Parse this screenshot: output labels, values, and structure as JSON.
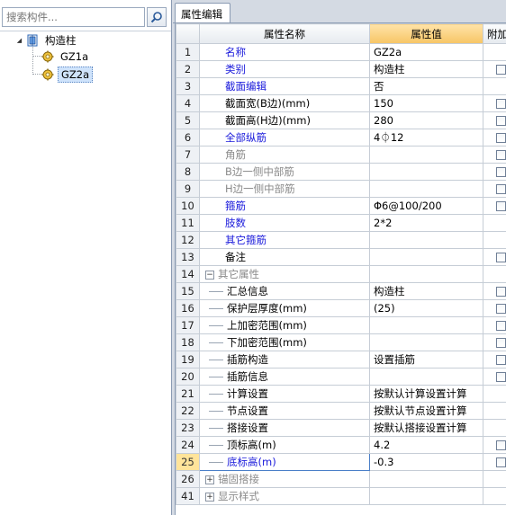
{
  "search": {
    "placeholder": "搜索构件..."
  },
  "tree": {
    "root_label": "构造柱",
    "children": [
      {
        "label": "GZ1a",
        "selected": false
      },
      {
        "label": "GZ2a",
        "selected": true
      }
    ]
  },
  "tab": {
    "label": "属性编辑"
  },
  "grid": {
    "headers": {
      "name": "属性名称",
      "value": "属性值",
      "extra": "附加"
    },
    "rows": [
      {
        "num": "1",
        "name": "名称",
        "value": "GZ2a",
        "style": "blue",
        "check": false
      },
      {
        "num": "2",
        "name": "类别",
        "value": "构造柱",
        "style": "blue",
        "check": true
      },
      {
        "num": "3",
        "name": "截面编辑",
        "value": "否",
        "style": "blue",
        "check": false
      },
      {
        "num": "4",
        "name": "截面宽(B边)(mm)",
        "value": "150",
        "style": "black",
        "check": true
      },
      {
        "num": "5",
        "name": "截面高(H边)(mm)",
        "value": "280",
        "style": "black",
        "check": true
      },
      {
        "num": "6",
        "name": "全部纵筋",
        "value": "4⏀12",
        "style": "blue",
        "check": true
      },
      {
        "num": "7",
        "name": "角筋",
        "value": "",
        "style": "gray",
        "check": true
      },
      {
        "num": "8",
        "name": "B边一侧中部筋",
        "value": "",
        "style": "gray",
        "check": true
      },
      {
        "num": "9",
        "name": "H边一侧中部筋",
        "value": "",
        "style": "gray",
        "check": true
      },
      {
        "num": "10",
        "name": "箍筋",
        "value": "Φ6@100/200",
        "style": "blue",
        "check": true
      },
      {
        "num": "11",
        "name": "肢数",
        "value": "2*2",
        "style": "blue",
        "check": false
      },
      {
        "num": "12",
        "name": "其它箍筋",
        "value": "",
        "style": "blue",
        "check": false
      },
      {
        "num": "13",
        "name": "备注",
        "value": "",
        "style": "black",
        "check": true
      },
      {
        "num": "14",
        "name": "其它属性",
        "value": "",
        "style": "gray",
        "check": false,
        "group": "minus"
      },
      {
        "num": "15",
        "name": "汇总信息",
        "value": "构造柱",
        "style": "black",
        "check": true,
        "indent": true
      },
      {
        "num": "16",
        "name": "保护层厚度(mm)",
        "value": "(25)",
        "style": "black",
        "check": true,
        "indent": true
      },
      {
        "num": "17",
        "name": "上加密范围(mm)",
        "value": "",
        "style": "black",
        "check": true,
        "indent": true
      },
      {
        "num": "18",
        "name": "下加密范围(mm)",
        "value": "",
        "style": "black",
        "check": true,
        "indent": true
      },
      {
        "num": "19",
        "name": "插筋构造",
        "value": "设置插筋",
        "style": "black",
        "check": true,
        "indent": true
      },
      {
        "num": "20",
        "name": "插筋信息",
        "value": "",
        "style": "black",
        "check": true,
        "indent": true
      },
      {
        "num": "21",
        "name": "计算设置",
        "value": "按默认计算设置计算",
        "style": "black",
        "check": false,
        "indent": true
      },
      {
        "num": "22",
        "name": "节点设置",
        "value": "按默认节点设置计算",
        "style": "black",
        "check": false,
        "indent": true
      },
      {
        "num": "23",
        "name": "搭接设置",
        "value": "按默认搭接设置计算",
        "style": "black",
        "check": false,
        "indent": true
      },
      {
        "num": "24",
        "name": "顶标高(m)",
        "value": "4.2",
        "style": "black",
        "check": true,
        "indent": true
      },
      {
        "num": "25",
        "name": "底标高(m)",
        "value": "-0.3",
        "style": "black",
        "check": true,
        "indent": true,
        "selected": true
      },
      {
        "num": "26",
        "name": "锚固搭接",
        "value": "",
        "style": "gray",
        "check": false,
        "group": "plus"
      },
      {
        "num": "41",
        "name": "显示样式",
        "value": "",
        "style": "gray",
        "check": false,
        "group": "plus"
      }
    ]
  }
}
